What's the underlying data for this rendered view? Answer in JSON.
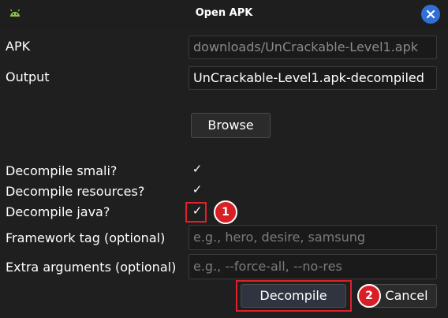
{
  "window": {
    "title": "Open APK",
    "app_icon": "android-icon",
    "close_icon": "close-icon"
  },
  "form": {
    "apk": {
      "label": "APK",
      "value": "downloads/UnCrackable-Level1.apk"
    },
    "output": {
      "label": "Output",
      "value": "UnCrackable-Level1.apk-decompiled"
    },
    "browse_label": "Browse",
    "decompile_smali": {
      "label": "Decompile smali?",
      "checked": true
    },
    "decompile_resources": {
      "label": "Decompile resources?",
      "checked": true
    },
    "decompile_java": {
      "label": "Decompile java?",
      "checked": true
    },
    "framework_tag": {
      "label": "Framework tag (optional)",
      "placeholder": "e.g., hero, desire, samsung"
    },
    "extra_args": {
      "label": "Extra arguments (optional)",
      "placeholder": "e.g., --force-all, --no-res"
    },
    "check_glyph": "✓"
  },
  "buttons": {
    "decompile_label": "Decompile",
    "cancel_label": "Cancel"
  },
  "annotations": {
    "badge1": "1",
    "badge2": "2",
    "highlight_color": "#e0202a"
  }
}
